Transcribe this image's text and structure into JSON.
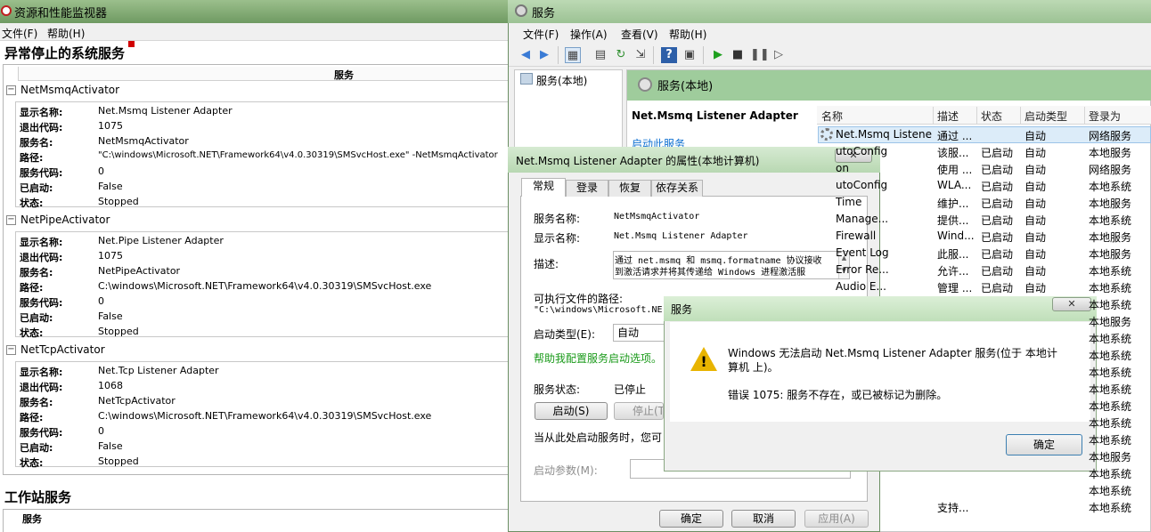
{
  "resource_monitor": {
    "title": "资源和性能监视器",
    "menu": [
      "文件(F)",
      "帮助(H)"
    ],
    "heading": "异常停止的系统服务",
    "column_header": "服务",
    "groups": [
      {
        "name": "NetMsmqActivator",
        "fields": [
          {
            "key": "显示名称:",
            "value": "Net.Msmq Listener Adapter"
          },
          {
            "key": "退出代码:",
            "value": "1075"
          },
          {
            "key": "服务名:",
            "value": "NetMsmqActivator"
          },
          {
            "key": "路径:",
            "value": "\"C:\\windows\\Microsoft.NET\\Framework64\\v4.0.30319\\SMSvcHost.exe\" -NetMsmqActivator"
          },
          {
            "key": "服务代码:",
            "value": "0"
          },
          {
            "key": "已启动:",
            "value": "False"
          },
          {
            "key": "状态:",
            "value": "Stopped"
          }
        ]
      },
      {
        "name": "NetPipeActivator",
        "fields": [
          {
            "key": "显示名称:",
            "value": "Net.Pipe Listener Adapter"
          },
          {
            "key": "退出代码:",
            "value": "1075"
          },
          {
            "key": "服务名:",
            "value": "NetPipeActivator"
          },
          {
            "key": "路径:",
            "value": "C:\\windows\\Microsoft.NET\\Framework64\\v4.0.30319\\SMSvcHost.exe"
          },
          {
            "key": "服务代码:",
            "value": "0"
          },
          {
            "key": "已启动:",
            "value": "False"
          },
          {
            "key": "状态:",
            "value": "Stopped"
          }
        ]
      },
      {
        "name": "NetTcpActivator",
        "fields": [
          {
            "key": "显示名称:",
            "value": "Net.Tcp Listener Adapter"
          },
          {
            "key": "退出代码:",
            "value": "1068"
          },
          {
            "key": "服务名:",
            "value": "NetTcpActivator"
          },
          {
            "key": "路径:",
            "value": "C:\\windows\\Microsoft.NET\\Framework64\\v4.0.30319\\SMSvcHost.exe"
          },
          {
            "key": "服务代码:",
            "value": "0"
          },
          {
            "key": "已启动:",
            "value": "False"
          },
          {
            "key": "状态:",
            "value": "Stopped"
          }
        ]
      }
    ],
    "section2_heading": "工作站服务",
    "section2_column": "服务"
  },
  "services": {
    "title": "服务",
    "menu": [
      "文件(F)",
      "操作(A)",
      "查看(V)",
      "帮助(H)"
    ],
    "tree_label": "服务(本地)",
    "right_title": "服务(本地)",
    "detail_name": "Net.Msmq Listener Adapter",
    "detail_link": "启动此服务",
    "columns": [
      "名称",
      "描述",
      "状态",
      "启动类型",
      "登录为"
    ],
    "rows": [
      {
        "name": "Net.Msmq Listene...",
        "desc": "通过 ...",
        "status": "",
        "start": "自动",
        "logon": "网络服务"
      },
      {
        "name": "utoConfig",
        "desc": "该服...",
        "status": "已启动",
        "start": "自动",
        "logon": "本地服务"
      },
      {
        "name": "on",
        "desc": "使用 ...",
        "status": "已启动",
        "start": "自动",
        "logon": "网络服务"
      },
      {
        "name": "utoConfig",
        "desc": "WLA...",
        "status": "已启动",
        "start": "自动",
        "logon": "本地系统"
      },
      {
        "name": "Time",
        "desc": "维护...",
        "status": "已启动",
        "start": "自动",
        "logon": "本地服务"
      },
      {
        "name": "Manage...",
        "desc": "提供...",
        "status": "已启动",
        "start": "自动",
        "logon": "本地系统"
      },
      {
        "name": "Firewall",
        "desc": "Wind...",
        "status": "已启动",
        "start": "自动",
        "logon": "本地服务"
      },
      {
        "name": "Event Log",
        "desc": "此服...",
        "status": "已启动",
        "start": "自动",
        "logon": "本地服务"
      },
      {
        "name": "Error Re...",
        "desc": "允许...",
        "status": "已启动",
        "start": "自动",
        "logon": "本地系统"
      },
      {
        "name": "Audio E...",
        "desc": "管理 ...",
        "status": "已启动",
        "start": "自动",
        "logon": "本地系统"
      },
      {
        "name": "",
        "desc": "",
        "status": "",
        "start": "",
        "logon": "本地系统"
      },
      {
        "name": "",
        "desc": "",
        "status": "",
        "start": "",
        "logon": "本地服务"
      },
      {
        "name": "",
        "desc": "",
        "status": "",
        "start": "",
        "logon": "本地系统"
      },
      {
        "name": "",
        "desc": "",
        "status": "",
        "start": "",
        "logon": "本地系统"
      },
      {
        "name": "",
        "desc": "",
        "status": "",
        "start": "",
        "logon": "本地系统"
      },
      {
        "name": "",
        "desc": "",
        "status": "",
        "start": "",
        "logon": "本地系统"
      },
      {
        "name": "",
        "desc": "",
        "status": "",
        "start": "",
        "logon": "本地系统"
      },
      {
        "name": "",
        "desc": "",
        "status": "",
        "start": "",
        "logon": "本地系统"
      },
      {
        "name": "",
        "desc": "",
        "status": "",
        "start": "",
        "logon": "本地系统"
      },
      {
        "name": "",
        "desc": "",
        "status": "",
        "start": "",
        "logon": "本地服务"
      },
      {
        "name": "",
        "desc": "",
        "status": "",
        "start": "",
        "logon": "本地系统"
      },
      {
        "name": "",
        "desc": "",
        "status": "",
        "start": "",
        "logon": "本地系统"
      },
      {
        "name": "",
        "desc": "支持...",
        "status": "",
        "start": "",
        "logon": "本地系统"
      }
    ]
  },
  "properties": {
    "title": "Net.Msmq Listener Adapter 的属性(本地计算机)",
    "tabs": [
      "常规",
      "登录",
      "恢复",
      "依存关系"
    ],
    "service_name_label": "服务名称:",
    "service_name": "NetMsmqActivator",
    "display_name_label": "显示名称:",
    "display_name": "Net.Msmq Listener Adapter",
    "desc_label": "描述:",
    "desc_line1": "通过 net.msmq 和 msmq.formatname 协议接收",
    "desc_line2": "到激活请求并将其传递给 Windows 进程激活服",
    "exe_label": "可执行文件的路径:",
    "exe_path": "\"C:\\windows\\Microsoft.NE",
    "start_type_label": "启动类型(E):",
    "start_type": "自动",
    "help_link": "帮助我配置服务启动选项。",
    "status_label": "服务状态:",
    "status": "已停止",
    "btn_start": "启动(S)",
    "btn_stop": "停止(T)",
    "hint": "当从此处启动服务时，您可",
    "params_label": "启动参数(M):",
    "btn_ok": "确定",
    "btn_cancel": "取消",
    "btn_apply": "应用(A)"
  },
  "error_dialog": {
    "title": "服务",
    "message": "Windows 无法启动 Net.Msmq Listener Adapter 服务(位于 本地计算机 上)。",
    "error": "错误 1075: 服务不存在，或已被标记为删除。",
    "ok": "确定"
  }
}
